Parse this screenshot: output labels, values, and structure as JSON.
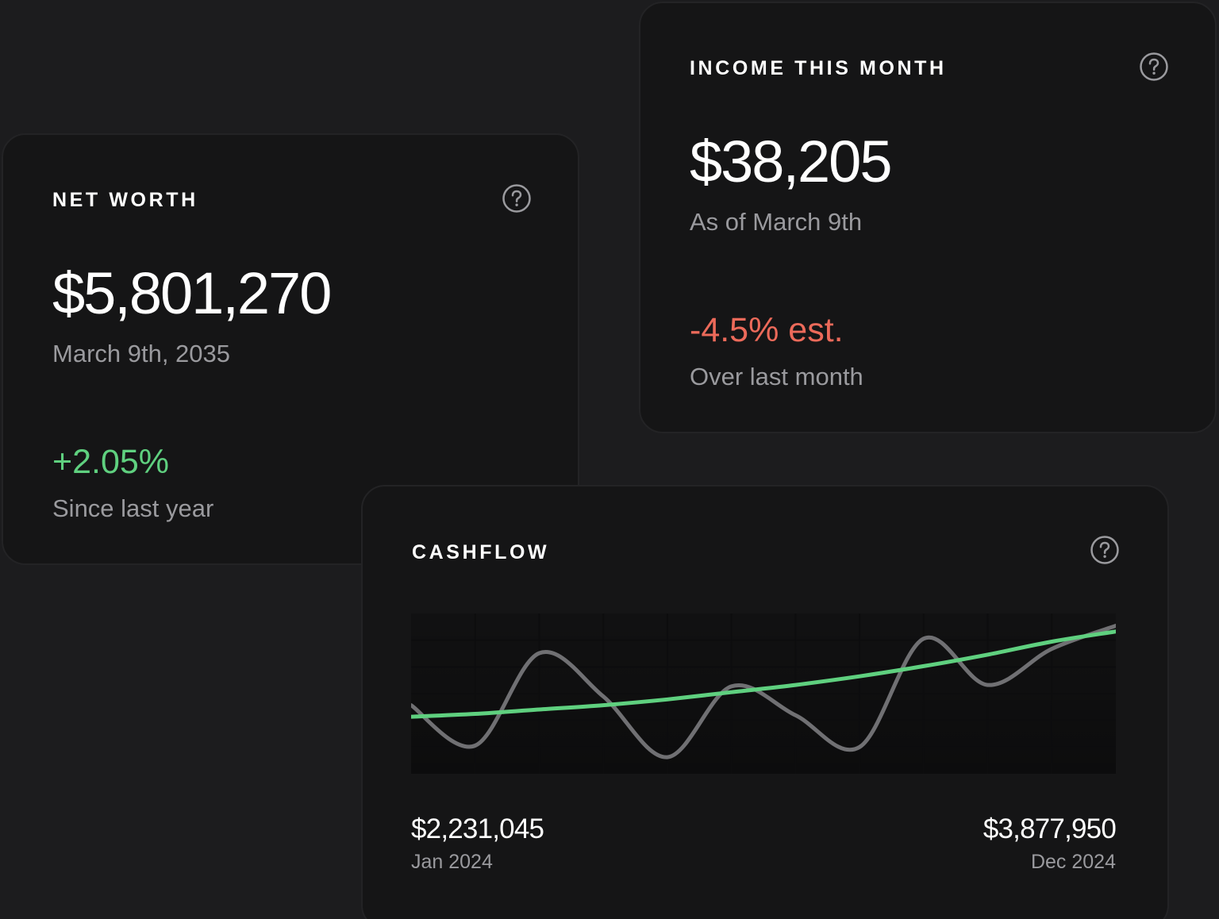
{
  "net_worth": {
    "title": "NET WORTH",
    "value": "$5,801,270",
    "date": "March 9th, 2035",
    "change": "+2.05%",
    "change_caption": "Since last year",
    "help_icon": "question-circle-icon"
  },
  "income": {
    "title": "INCOME THIS MONTH",
    "value": "$38,205",
    "date": "As of March 9th",
    "change": "-4.5% est.",
    "change_caption": "Over last month",
    "help_icon": "question-circle-icon"
  },
  "cashflow": {
    "title": "CASHFLOW",
    "help_icon": "question-circle-icon",
    "start_value": "$2,231,045",
    "start_label": "Jan 2024",
    "end_value": "$3,877,950",
    "end_label": "Dec 2024"
  },
  "colors": {
    "background": "#1c1c1e",
    "card": "#151516",
    "positive": "#5fd07f",
    "negative": "#ec6a5a",
    "muted_text": "#9a9a9e",
    "actual_line": "#707073",
    "trend_line": "#5fd07f"
  },
  "chart_data": {
    "type": "line",
    "grid": true,
    "x_range": [
      "Jan 2024",
      "Dec 2024"
    ],
    "y_range": [
      2231045,
      3877950
    ],
    "series": [
      {
        "color": "#707073",
        "values": [
          0.42,
          0.14,
          0.78,
          0.48,
          0.06,
          0.55,
          0.35,
          0.13,
          0.88,
          0.56,
          0.81,
          0.97
        ]
      },
      {
        "color": "#5fd07f",
        "values": [
          0.34,
          0.36,
          0.39,
          0.42,
          0.46,
          0.51,
          0.56,
          0.62,
          0.69,
          0.77,
          0.86,
          0.93
        ]
      }
    ]
  }
}
